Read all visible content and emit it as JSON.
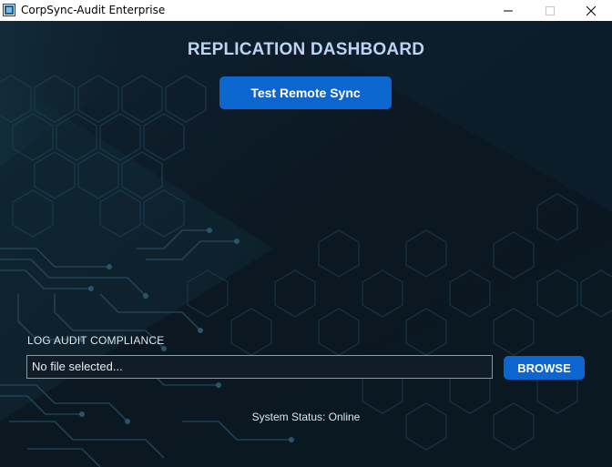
{
  "window": {
    "title": "CorpSync-Audit Enterprise",
    "controls": [
      "minimize-icon",
      "maximize-icon",
      "close-icon"
    ]
  },
  "dashboard": {
    "heading": "REPLICATION DASHBOARD",
    "test_button_label": "Test Remote Sync"
  },
  "log_audit": {
    "label": "LOG AUDIT COMPLIANCE",
    "file_value": "No file selected...",
    "browse_label": "BROWSE"
  },
  "status": {
    "text": "System Status: Online"
  },
  "colors": {
    "accent": "#0b66cf",
    "background": "#0b1721",
    "heading": "#bcd3f5"
  }
}
